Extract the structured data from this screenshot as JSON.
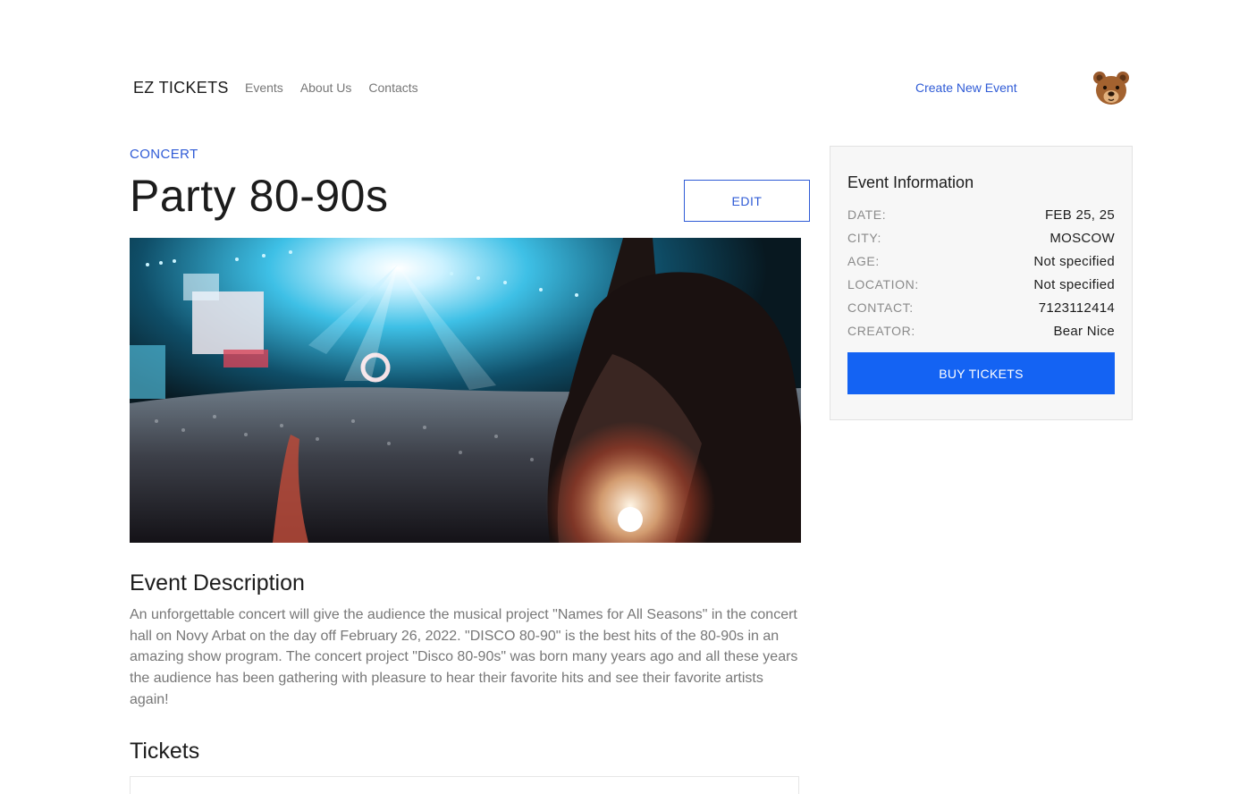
{
  "header": {
    "logo": "EZ TICKETS",
    "nav": [
      "Events",
      "About Us",
      "Contacts"
    ],
    "create_event": "Create New Event",
    "avatar_icon": "bear-face-icon"
  },
  "event": {
    "category": "CONCERT",
    "title": "Party 80-90s",
    "edit_label": "EDIT",
    "image_icon": "concert-crowd-photo",
    "description_heading": "Event Description",
    "description": "An unforgettable concert will give the audience the musical project \"Names for All Seasons\" in the concert hall on Novy Arbat on the day off February 26, 2022. \"DISCO 80-90\" is the best hits of the 80-90s in an amazing show program. The concert project \"Disco 80-90s\" was born many years ago and all these years the audience has been gathering with pleasure to hear their favorite hits and see their favorite artists again!",
    "tickets_heading": "Tickets"
  },
  "info": {
    "title": "Event Information",
    "rows": [
      {
        "label": "DATE:",
        "value": "FEB 25, 25"
      },
      {
        "label": "CITY:",
        "value": "MOSCOW"
      },
      {
        "label": "AGE:",
        "value": "Not specified"
      },
      {
        "label": "LOCATION:",
        "value": "Not specified"
      },
      {
        "label": "CONTACT:",
        "value": "7123112414"
      },
      {
        "label": "CREATOR:",
        "value": "Bear Nice"
      }
    ],
    "buy_label": "BUY TICKETS"
  },
  "colors": {
    "accent": "#2f5bd6",
    "buy_button": "#1463f3"
  }
}
